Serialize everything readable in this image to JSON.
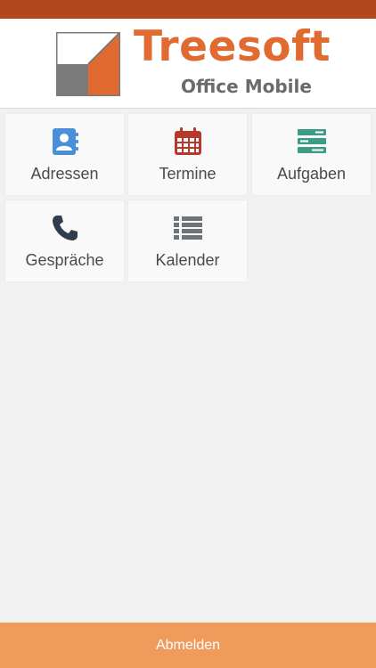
{
  "colors": {
    "status_bar": "#b3481e",
    "brand_orange": "#e06a2f",
    "brand_gray": "#6b6b6b",
    "logout_bg": "#ef9b5c"
  },
  "header": {
    "logo_title": "Treesoft",
    "logo_subtitle": "Office Mobile"
  },
  "tiles": [
    {
      "label": "Adressen",
      "icon": "address-book-icon",
      "color": "#4a90d9"
    },
    {
      "label": "Termine",
      "icon": "calendar-icon",
      "color": "#b8382e"
    },
    {
      "label": "Aufgaben",
      "icon": "tasks-icon",
      "color": "#3d9c86"
    },
    {
      "label": "Gespräche",
      "icon": "phone-icon",
      "color": "#2f3d4c"
    },
    {
      "label": "Kalender",
      "icon": "list-icon",
      "color": "#6f7478"
    }
  ],
  "footer": {
    "logout_label": "Abmelden"
  }
}
